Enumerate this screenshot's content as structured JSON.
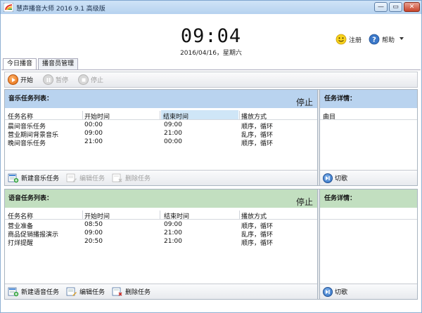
{
  "window": {
    "title": "慧声播音大师 2016 9.1 高级版",
    "minimize_glyph": "—",
    "restore_glyph": "▭",
    "close_glyph": "✕"
  },
  "clock": {
    "time": "09:04",
    "date": "2016/04/16，星期六"
  },
  "top_actions": {
    "register": "注册",
    "help": "帮助"
  },
  "tabs": [
    {
      "label": "今日播音",
      "active": true
    },
    {
      "label": "播音员管理",
      "active": false
    }
  ],
  "toolbar": {
    "start": "开始",
    "pause": "暂停",
    "stop": "停止"
  },
  "music_panel": {
    "title": "音乐任务列表：",
    "status": "停止",
    "detail_title": "任务详情：",
    "detail_column": "曲目",
    "columns": [
      "任务名称",
      "开始时间",
      "结束时间",
      "播放方式"
    ],
    "rows": [
      [
        "晨间音乐任务",
        "00:00",
        "09:00",
        "顺序，循环"
      ],
      [
        "营业期间背景音乐",
        "09:00",
        "21:00",
        "乱序，循环"
      ],
      [
        "晚间音乐任务",
        "21:00",
        "00:00",
        "顺序，循环"
      ]
    ],
    "new_task": "新建音乐任务",
    "edit_task": "编辑任务",
    "delete_task": "删除任务",
    "switch_song": "切歌"
  },
  "voice_panel": {
    "title": "语音任务列表：",
    "status": "停止",
    "detail_title": "任务详情：",
    "columns": [
      "任务名称",
      "开始时间",
      "结束时间",
      "播放方式"
    ],
    "rows": [
      [
        "营业准备",
        "08:50",
        "09:00",
        "顺序，循环"
      ],
      [
        "商品促销播报演示",
        "09:00",
        "21:00",
        "乱序，循环"
      ],
      [
        "打烊提醒",
        "20:50",
        "21:00",
        "顺序，循环"
      ]
    ],
    "new_task": "新建语音任务",
    "edit_task": "编辑任务",
    "delete_task": "删除任务",
    "switch_song": "切歌"
  },
  "colors": {
    "music_header": "#b9d3ef",
    "voice_header": "#c2dfc0",
    "highlight_header": "#cfe6f7"
  }
}
